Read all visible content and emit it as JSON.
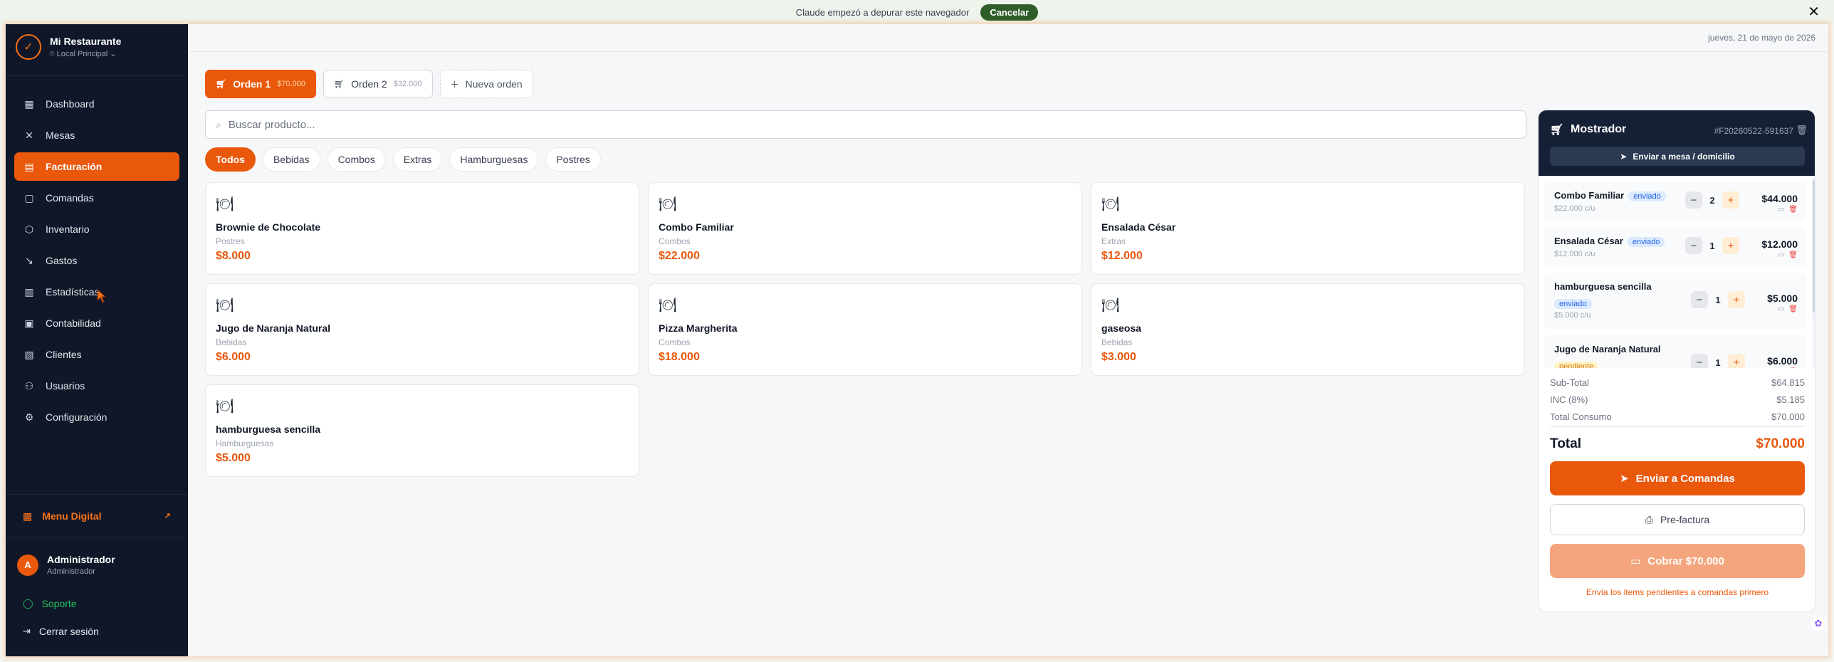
{
  "banner": {
    "message": "Claude empezó a depurar este navegador",
    "cancel_label": "Cancelar",
    "close_glyph": "✕"
  },
  "sidebar": {
    "brand_name": "Mi Restaurante",
    "location": "Local Principal",
    "items": [
      {
        "label": "Dashboard",
        "icon": "dashboard-icon",
        "glyph": "▦"
      },
      {
        "label": "Mesas",
        "icon": "utensils-icon",
        "glyph": "✕"
      },
      {
        "label": "Facturación",
        "icon": "invoice-icon",
        "glyph": "▤"
      },
      {
        "label": "Comandas",
        "icon": "clipboard-icon",
        "glyph": "▢"
      },
      {
        "label": "Inventario",
        "icon": "package-icon",
        "glyph": "⬡"
      },
      {
        "label": "Gastos",
        "icon": "trending-down-icon",
        "glyph": "↘"
      },
      {
        "label": "Estadísticas",
        "icon": "bar-chart-icon",
        "glyph": "▥"
      },
      {
        "label": "Contabilidad",
        "icon": "book-icon",
        "glyph": "▣"
      },
      {
        "label": "Clientes",
        "icon": "contact-icon",
        "glyph": "▧"
      },
      {
        "label": "Usuarios",
        "icon": "users-icon",
        "glyph": "⚇"
      },
      {
        "label": "Configuración",
        "icon": "gear-icon",
        "glyph": "⚙"
      }
    ],
    "active_index": 2,
    "menu_digital_label": "Menu Digital",
    "user_initial": "A",
    "user_name": "Administrador",
    "user_role": "Administrador",
    "support_label": "Soporte",
    "logout_label": "Cerrar sesión"
  },
  "header": {
    "date": "jueves, 21 de mayo de 2026"
  },
  "orders": {
    "tabs": [
      {
        "label": "Orden 1",
        "amount": "$70.000",
        "active": true
      },
      {
        "label": "Orden 2",
        "amount": "$32.000",
        "active": false
      }
    ],
    "new_label": "Nueva orden"
  },
  "search": {
    "placeholder": "Buscar producto..."
  },
  "categories": [
    "Todos",
    "Bebidas",
    "Combos",
    "Extras",
    "Hamburguesas",
    "Postres"
  ],
  "products": [
    {
      "name": "Brownie de Chocolate",
      "category": "Postres",
      "price": "$8.000"
    },
    {
      "name": "Combo Familiar",
      "category": "Combos",
      "price": "$22.000"
    },
    {
      "name": "Ensalada César",
      "category": "Extras",
      "price": "$12.000"
    },
    {
      "name": "Jugo de Naranja Natural",
      "category": "Bebidas",
      "price": "$6.000"
    },
    {
      "name": "Pizza Margherita",
      "category": "Combos",
      "price": "$18.000"
    },
    {
      "name": "gaseosa",
      "category": "Bebidas",
      "price": "$3.000"
    },
    {
      "name": "hamburguesa sencilla",
      "category": "Hamburguesas",
      "price": "$5.000"
    }
  ],
  "cart": {
    "title": "Mostrador",
    "invoice": "#F20260522-591637",
    "send_table_label": "Enviar a mesa / domicilio",
    "items": [
      {
        "name": "Combo Familiar",
        "status": "enviado",
        "unit": "$22.000 c/u",
        "qty": "2",
        "total": "$44.000"
      },
      {
        "name": "Ensalada César",
        "status": "enviado",
        "unit": "$12.000 c/u",
        "qty": "1",
        "total": "$12.000"
      },
      {
        "name": "hamburguesa sencilla",
        "status": "enviado",
        "unit": "$5.000 c/u",
        "qty": "1",
        "total": "$5.000"
      },
      {
        "name": "Jugo de Naranja Natural",
        "status": "pendiente",
        "unit": "",
        "qty": "1",
        "total": "$6.000"
      }
    ],
    "subtotal_label": "Sub-Total",
    "subtotal": "$64.815",
    "inc_label": "INC (8%)",
    "inc": "$5.185",
    "consumo_label": "Total Consumo",
    "consumo": "$70.000",
    "total_label": "Total",
    "total": "$70.000",
    "send_kitchen_label": "Enviar a Comandas",
    "prefactura_label": "Pre-factura",
    "pay_label": "Cobrar $70.000",
    "hint": "Envía los items pendientes a comandas primero"
  },
  "colors": {
    "accent": "#ea580c",
    "sidebar_bg": "#0f1729",
    "panel_header_bg": "#152036"
  }
}
